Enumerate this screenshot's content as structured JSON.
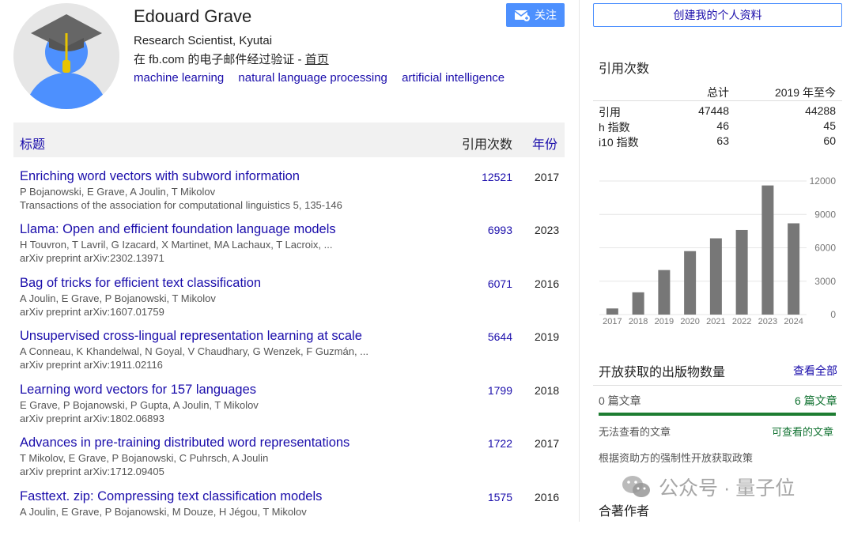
{
  "profile": {
    "name": "Edouard Grave",
    "affiliation": "Research Scientist, Kyutai",
    "verified_prefix": "在 fb.com 的电子邮件经过验证 - ",
    "homepage_label": "首页",
    "interests": [
      "machine learning",
      "natural language processing",
      "artificial intelligence"
    ],
    "follow_label": "关注"
  },
  "table": {
    "header_title": "标题",
    "header_cites": "引用次数",
    "header_year": "年份",
    "rows": [
      {
        "title": "Enriching word vectors with subword information",
        "authors": "P Bojanowski, E Grave, A Joulin, T Mikolov",
        "venue": "Transactions of the association for computational linguistics 5, 135-146",
        "cites": "12521",
        "year": "2017"
      },
      {
        "title": "Llama: Open and efficient foundation language models",
        "authors": "H Touvron, T Lavril, G Izacard, X Martinet, MA Lachaux, T Lacroix, ...",
        "venue": "arXiv preprint arXiv:2302.13971",
        "cites": "6993",
        "year": "2023"
      },
      {
        "title": "Bag of tricks for efficient text classification",
        "authors": "A Joulin, E Grave, P Bojanowski, T Mikolov",
        "venue": "arXiv preprint arXiv:1607.01759",
        "cites": "6071",
        "year": "2016"
      },
      {
        "title": "Unsupervised cross-lingual representation learning at scale",
        "authors": "A Conneau, K Khandelwal, N Goyal, V Chaudhary, G Wenzek, F Guzmán, ...",
        "venue": "arXiv preprint arXiv:1911.02116",
        "cites": "5644",
        "year": "2019"
      },
      {
        "title": "Learning word vectors for 157 languages",
        "authors": "E Grave, P Bojanowski, P Gupta, A Joulin, T Mikolov",
        "venue": "arXiv preprint arXiv:1802.06893",
        "cites": "1799",
        "year": "2018"
      },
      {
        "title": "Advances in pre-training distributed word representations",
        "authors": "T Mikolov, E Grave, P Bojanowski, C Puhrsch, A Joulin",
        "venue": "arXiv preprint arXiv:1712.09405",
        "cites": "1722",
        "year": "2017"
      },
      {
        "title": "Fasttext. zip: Compressing text classification models",
        "authors": "A Joulin, E Grave, P Bojanowski, M Douze, H Jégou, T Mikolov",
        "venue": "",
        "cites": "1575",
        "year": "2016"
      }
    ]
  },
  "sidebar": {
    "create_profile_label": "创建我的个人资料",
    "cited_by_heading": "引用次数",
    "col_total": "总计",
    "col_since": "2019 年至今",
    "metrics": [
      {
        "label": "引用",
        "total": "47448",
        "since": "44288"
      },
      {
        "label": "h 指数",
        "total": "46",
        "since": "45"
      },
      {
        "label": "i10 指数",
        "total": "63",
        "since": "60"
      }
    ],
    "open_access": {
      "heading": "开放获取的出版物数量",
      "view_all": "查看全部",
      "unavailable_count": "0 篇文章",
      "available_count": "6 篇文章",
      "unavailable_label": "无法查看的文章",
      "available_label": "可查看的文章",
      "policy_text": "根据资助方的强制性开放获取政策",
      "available_fraction": 1.0
    },
    "coauthors_heading": "合著作者"
  },
  "watermark": {
    "text": "公众号 · 量子位"
  },
  "colors": {
    "bar": "#777777",
    "link": "#1a0dab",
    "accent": "#4d90fe",
    "oa_green": "#1e7d32"
  },
  "chart_data": {
    "type": "bar",
    "categories": [
      "2017",
      "2018",
      "2019",
      "2020",
      "2021",
      "2022",
      "2023",
      "2024"
    ],
    "values": [
      550,
      2000,
      4000,
      5700,
      6850,
      7600,
      11600,
      8200
    ],
    "ylim": [
      0,
      12000
    ],
    "yticks": [
      "12000",
      "9000",
      "6000",
      "3000",
      "0"
    ],
    "ytick_values": [
      12000,
      9000,
      6000,
      3000,
      0
    ],
    "grid": true
  }
}
